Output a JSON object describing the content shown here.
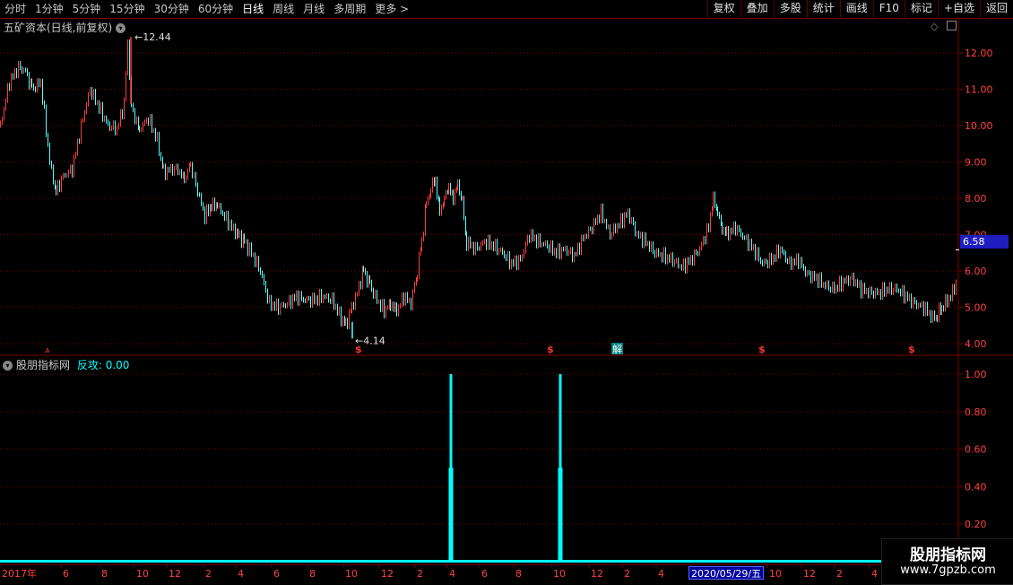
{
  "toolbar": {
    "periods": [
      "分时",
      "1分钟",
      "5分钟",
      "15分钟",
      "30分钟",
      "60分钟",
      "日线",
      "周线",
      "月线",
      "多周期",
      "更多 >"
    ],
    "active_period": "日线",
    "right_buttons": [
      "复权",
      "叠加",
      "多股",
      "统计",
      "画线",
      "F10",
      "标记",
      "+自选",
      "返回"
    ]
  },
  "main_pane": {
    "title": "五矿资本(日线,前复权)",
    "high_label": "12.44",
    "low_label": "4.14",
    "current_price": "6.58",
    "right_axis": [
      "12.00",
      "11.00",
      "10.00",
      "9.00",
      "8.00",
      "7.00",
      "6.00",
      "5.00",
      "4.00"
    ],
    "event_markers": [
      "$",
      "$",
      "解",
      "$",
      "$"
    ]
  },
  "indicator_pane": {
    "title": "股朋指标网",
    "series_label": "反攻: 0.00",
    "right_axis": [
      "1.00",
      "0.80",
      "0.60",
      "0.40",
      "0.20"
    ]
  },
  "time_axis": {
    "labels": [
      "2017年",
      "6",
      "8",
      "10",
      "12",
      "2",
      "4",
      "6",
      "8",
      "10",
      "12",
      "2",
      "4",
      "6",
      "8",
      "10",
      "12",
      "2",
      "4",
      "2020/05/29/五",
      "10",
      "12",
      "2",
      "4"
    ],
    "cursor_date": "2020/05/29/五"
  },
  "watermark": {
    "line1": "股朋指标网",
    "line2": "www.7gpzb.com"
  },
  "colors": {
    "up": "#ff3c3c",
    "down": "#54ffff",
    "grid": "#800000",
    "indicator": "#00ffff",
    "axis_text": "#ff4040"
  },
  "chart_data": [
    {
      "type": "line",
      "note": "",
      "series": [
        {
          "name": "",
          "x_index": [
            0,
            10,
            20,
            28,
            35,
            45,
            55,
            62,
            70,
            80,
            92,
            100,
            110,
            120,
            130,
            138,
            142,
            146,
            155,
            165,
            175,
            182,
            190,
            198,
            205,
            212,
            220,
            228,
            235,
            242,
            250,
            258,
            265,
            272,
            280,
            290,
            300,
            310,
            320,
            330,
            340,
            350,
            360,
            370,
            378,
            385,
            392,
            398,
            405,
            412,
            420,
            428,
            435,
            442,
            450,
            458,
            465,
            470,
            475,
            480,
            485,
            490,
            495,
            500,
            505,
            510,
            515,
            520,
            530,
            540,
            550,
            560,
            570,
            580,
            590,
            600,
            610,
            620,
            630,
            640,
            650,
            660,
            670,
            680,
            690,
            700,
            710,
            720,
            730,
            740,
            750,
            760,
            770,
            780,
            790,
            795,
            800,
            805,
            810,
            820,
            830,
            840,
            850,
            860,
            870,
            880,
            890,
            900,
            910,
            920,
            930,
            940,
            950,
            960,
            970,
            980,
            990,
            1000,
            1010,
            1020,
            1030,
            1040,
            1045,
            1050,
            1060,
            1068
          ],
          "close": [
            10.0,
            11.2,
            11.6,
            11.5,
            11.0,
            11.2,
            9.0,
            8.2,
            8.6,
            8.8,
            10.2,
            11.0,
            10.5,
            10.0,
            9.9,
            10.6,
            12.3,
            10.5,
            9.9,
            10.2,
            9.6,
            8.7,
            8.8,
            8.8,
            8.5,
            8.9,
            8.2,
            7.5,
            7.8,
            7.8,
            7.5,
            7.2,
            7.0,
            6.8,
            6.5,
            6.0,
            5.1,
            5.0,
            5.1,
            5.3,
            5.2,
            5.2,
            5.3,
            5.2,
            4.8,
            4.5,
            5.0,
            5.4,
            6.0,
            5.6,
            5.2,
            4.9,
            5.1,
            4.9,
            5.3,
            5.1,
            6.0,
            6.8,
            7.8,
            8.3,
            8.5,
            7.6,
            8.0,
            8.3,
            8.0,
            8.4,
            7.9,
            6.8,
            6.6,
            6.8,
            6.7,
            6.5,
            6.2,
            6.3,
            7.0,
            6.8,
            6.7,
            6.5,
            6.6,
            6.4,
            6.9,
            7.2,
            7.6,
            7.0,
            7.3,
            7.6,
            7.0,
            6.8,
            6.5,
            6.4,
            6.3,
            6.1,
            6.3,
            6.6,
            7.2,
            8.0,
            7.6,
            7.2,
            7.0,
            7.2,
            6.9,
            6.6,
            6.2,
            6.3,
            6.6,
            6.2,
            6.3,
            5.9,
            5.8,
            5.6,
            5.5,
            5.7,
            5.8,
            5.5,
            5.4,
            5.4,
            5.5,
            5.5,
            5.3,
            5.1,
            5.0,
            4.7,
            4.8,
            5.0,
            5.3,
            5.8
          ],
          "high": 12.44,
          "low": 4.14,
          "last": 6.58
        }
      ],
      "ylim": [
        3.7,
        12.9
      ]
    },
    {
      "type": "bar",
      "note": "",
      "series": [
        {
          "name": "反攻",
          "spikes": [
            {
              "x_label": "4",
              "value": 1.0
            },
            {
              "x_label": "10",
              "value": 1.0
            }
          ],
          "last": 0.0
        }
      ],
      "ylim": [
        0,
        1.05
      ]
    }
  ]
}
